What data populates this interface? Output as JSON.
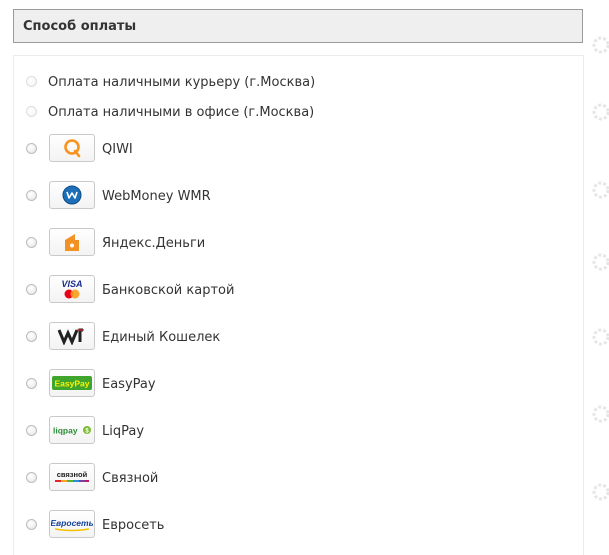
{
  "header": {
    "title": "Способ оплаты"
  },
  "options": [
    {
      "label": "Оплата наличными курьеру (г.Москва)",
      "icon": null
    },
    {
      "label": "Оплата наличными в офисе (г.Москва)",
      "icon": null
    },
    {
      "label": "QIWI",
      "icon": "qiwi-logo-icon"
    },
    {
      "label": "WebMoney WMR",
      "icon": "webmoney-logo-icon"
    },
    {
      "label": "Яндекс.Деньги",
      "icon": "yandex-money-logo-icon"
    },
    {
      "label": "Банковской картой",
      "icon": "visa-mastercard-logo-icon"
    },
    {
      "label": "Единый Кошелек",
      "icon": "w1-logo-icon"
    },
    {
      "label": "EasyPay",
      "icon": "easypay-logo-icon"
    },
    {
      "label": "LiqPay",
      "icon": "liqpay-logo-icon"
    },
    {
      "label": "Связной",
      "icon": "svyaznoy-logo-icon"
    },
    {
      "label": "Евросеть",
      "icon": "euroset-logo-icon"
    }
  ],
  "logos": {
    "visa": "VISA",
    "easypay": "EasyPay",
    "liqpay": "liqpay",
    "svyaznoy": "связной",
    "euroset": "Евросеть"
  }
}
